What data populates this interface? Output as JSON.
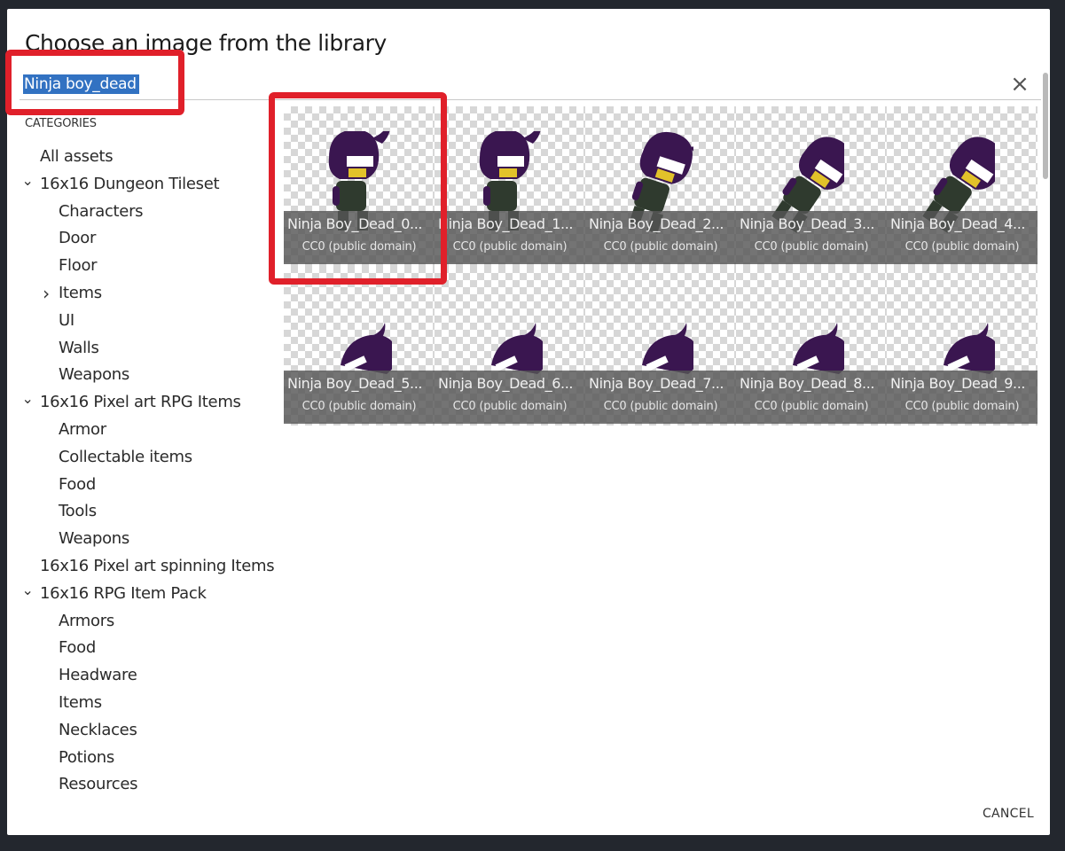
{
  "dialog": {
    "title": "Choose an image from the library",
    "cancel_label": "CANCEL",
    "close_glyph": "×"
  },
  "search": {
    "value": "Ninja boy_dead"
  },
  "sidebar": {
    "header": "CATEGORIES",
    "items": [
      {
        "label": "All assets",
        "level": 0,
        "caret": ""
      },
      {
        "label": "16x16 Dungeon Tileset",
        "level": 0,
        "caret": "expanded"
      },
      {
        "label": "Characters",
        "level": 1,
        "caret": ""
      },
      {
        "label": "Door",
        "level": 1,
        "caret": ""
      },
      {
        "label": "Floor",
        "level": 1,
        "caret": ""
      },
      {
        "label": "Items",
        "level": 1,
        "caret": "collapsed"
      },
      {
        "label": "UI",
        "level": 1,
        "caret": ""
      },
      {
        "label": "Walls",
        "level": 1,
        "caret": ""
      },
      {
        "label": "Weapons",
        "level": 1,
        "caret": ""
      },
      {
        "label": "16x16 Pixel art RPG Items",
        "level": 0,
        "caret": "expanded"
      },
      {
        "label": "Armor",
        "level": 1,
        "caret": ""
      },
      {
        "label": "Collectable items",
        "level": 1,
        "caret": ""
      },
      {
        "label": "Food",
        "level": 1,
        "caret": ""
      },
      {
        "label": "Tools",
        "level": 1,
        "caret": ""
      },
      {
        "label": "Weapons",
        "level": 1,
        "caret": ""
      },
      {
        "label": "16x16 Pixel art spinning Items",
        "level": 0,
        "caret": ""
      },
      {
        "label": "16x16 RPG Item Pack",
        "level": 0,
        "caret": "expanded"
      },
      {
        "label": "Armors",
        "level": 1,
        "caret": ""
      },
      {
        "label": "Food",
        "level": 1,
        "caret": ""
      },
      {
        "label": "Headware",
        "level": 1,
        "caret": ""
      },
      {
        "label": "Items",
        "level": 1,
        "caret": ""
      },
      {
        "label": "Necklaces",
        "level": 1,
        "caret": ""
      },
      {
        "label": "Potions",
        "level": 1,
        "caret": ""
      },
      {
        "label": "Resources",
        "level": 1,
        "caret": ""
      }
    ]
  },
  "assets": [
    {
      "name": "Ninja Boy_Dead_0...",
      "license": "CC0 (public domain)",
      "pose": "standing"
    },
    {
      "name": "Ninja Boy_Dead_1...",
      "license": "CC0 (public domain)",
      "pose": "standing"
    },
    {
      "name": "Ninja Boy_Dead_2...",
      "license": "CC0 (public domain)",
      "pose": "leaning"
    },
    {
      "name": "Ninja Boy_Dead_3...",
      "license": "CC0 (public domain)",
      "pose": "falling"
    },
    {
      "name": "Ninja Boy_Dead_4...",
      "license": "CC0 (public domain)",
      "pose": "falling"
    },
    {
      "name": "Ninja Boy_Dead_5...",
      "license": "CC0 (public domain)",
      "pose": "lying"
    },
    {
      "name": "Ninja Boy_Dead_6...",
      "license": "CC0 (public domain)",
      "pose": "lying"
    },
    {
      "name": "Ninja Boy_Dead_7...",
      "license": "CC0 (public domain)",
      "pose": "lying"
    },
    {
      "name": "Ninja Boy_Dead_8...",
      "license": "CC0 (public domain)",
      "pose": "lying"
    },
    {
      "name": "Ninja Boy_Dead_9...",
      "license": "CC0 (public domain)",
      "pose": "lying"
    }
  ],
  "icons": {
    "close": "close-icon",
    "expanded": "chevron-down-icon",
    "collapsed": "chevron-right-icon"
  },
  "colors": {
    "selection": "#3272c2",
    "highlight": "#e0202a",
    "sprite_hood": "#3a1650",
    "sprite_suit": "#2f3a2e",
    "sprite_accent": "#e2c22a"
  }
}
